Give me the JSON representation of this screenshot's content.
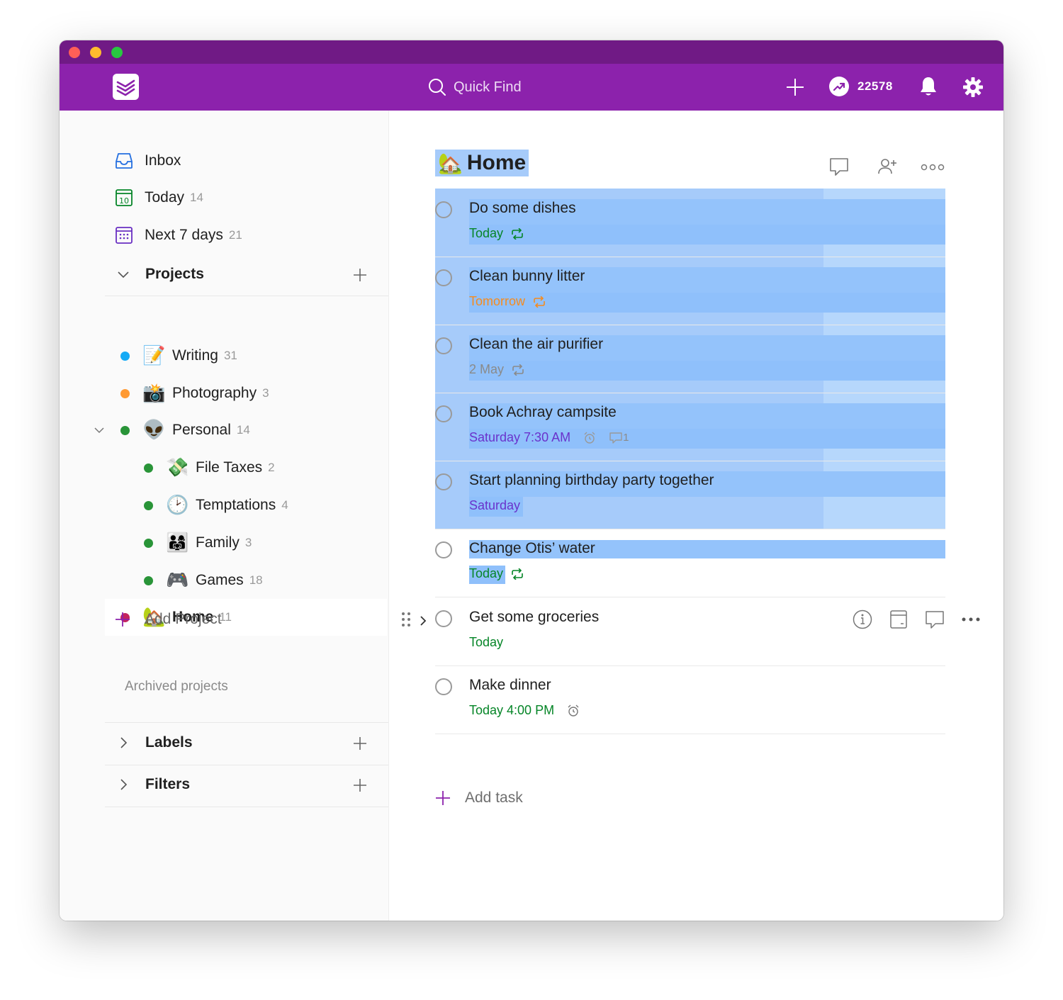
{
  "colors": {
    "titlebar": "#701a85",
    "topbar": "#8c22ac",
    "green": "#058527",
    "orange": "#f58b1f",
    "purple": "#6a33cc",
    "selection": "#a6cbfa"
  },
  "topbar": {
    "logo_icon": "todoist-logo-icon",
    "search_placeholder": "Quick Find",
    "karma_count": "22578"
  },
  "sidebar": {
    "nav": [
      {
        "label": "Inbox",
        "count": "",
        "icon": "inbox-icon"
      },
      {
        "label": "Today",
        "count": "14",
        "icon": "calendar-today-icon"
      },
      {
        "label": "Next 7 days",
        "count": "21",
        "icon": "calendar-week-icon"
      }
    ],
    "projects_heading": "Projects",
    "projects": [
      {
        "name": "Writing",
        "count": "31",
        "color": "#14aaf5",
        "emoji": "📝"
      },
      {
        "name": "Photography",
        "count": "3",
        "color": "#ff9a33",
        "emoji": "📸"
      },
      {
        "name": "Personal",
        "count": "14",
        "color": "#299438",
        "emoji": "👽"
      },
      {
        "name": "File Taxes",
        "count": "2",
        "color": "#299438",
        "emoji": "💸"
      },
      {
        "name": "Temptations",
        "count": "4",
        "color": "#299438",
        "emoji": "🕑"
      },
      {
        "name": "Family",
        "count": "3",
        "color": "#299438",
        "emoji": "👨‍👩‍👧"
      },
      {
        "name": "Games",
        "count": "18",
        "color": "#299438",
        "emoji": "🎮"
      },
      {
        "name": "Home",
        "count": "11",
        "color": "#c4245e",
        "emoji": "🏡"
      }
    ],
    "add_project": "Add Project",
    "archived": "Archived projects",
    "labels_heading": "Labels",
    "filters_heading": "Filters"
  },
  "main": {
    "title": "Home",
    "title_emoji": "🏡",
    "tasks": [
      {
        "title": "Do some dishes",
        "date": "Today",
        "date_color": "green",
        "recurring": true
      },
      {
        "title": "Clean bunny litter",
        "date": "Tomorrow",
        "date_color": "orange",
        "recurring": true
      },
      {
        "title": "Clean the air purifier",
        "date": "2 May",
        "date_color": "grey",
        "recurring": true
      },
      {
        "title": "Book Achray campsite",
        "date": "Saturday 7:30 AM",
        "date_color": "purple",
        "alarm": true,
        "comments": "1"
      },
      {
        "title": "Start planning birthday party together",
        "date": "Saturday",
        "date_color": "purple"
      },
      {
        "title": "Change Otis’ water",
        "date": "Today",
        "date_color": "green",
        "recurring": true
      },
      {
        "title": "Get some groceries",
        "date": "Today",
        "date_color": "green"
      },
      {
        "title": "Make dinner",
        "date": "Today 4:00 PM",
        "date_color": "green",
        "alarm": true
      }
    ],
    "add_task": "Add task"
  }
}
